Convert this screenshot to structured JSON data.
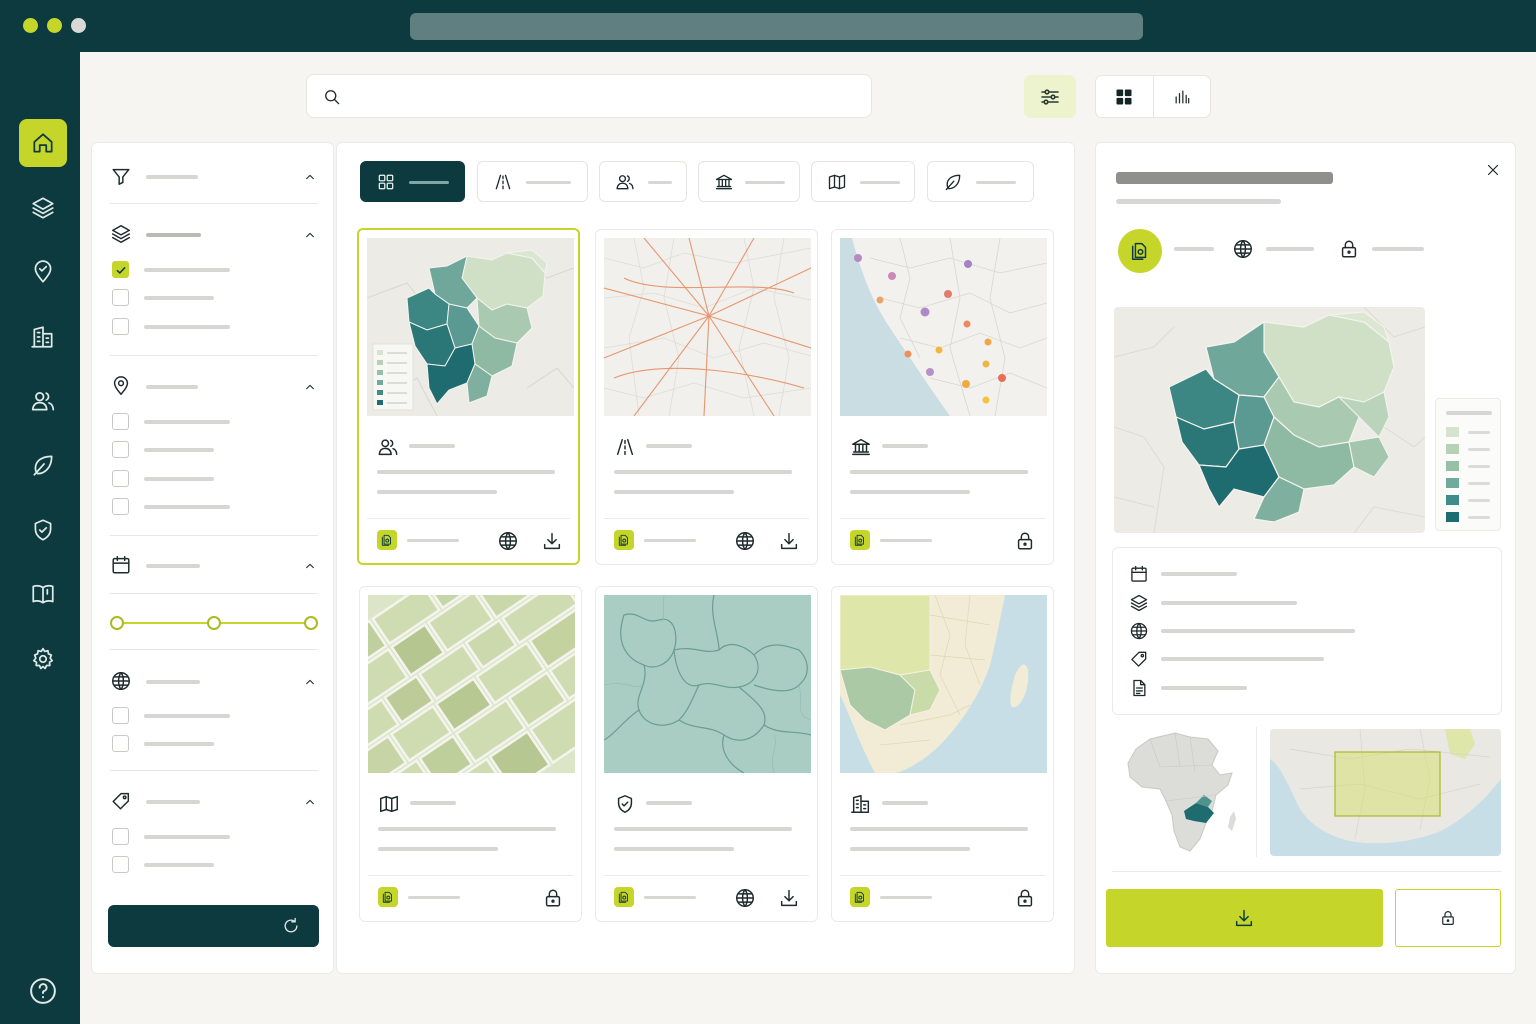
{
  "window": {
    "traffic_lights": [
      "#c6d52a",
      "#c6d52a",
      "#d9d9d6"
    ],
    "url": ""
  },
  "colors": {
    "accent": "#c6d52a",
    "sidebar": "#0c3a3e",
    "canvas": "#f6f5f2",
    "teal_dark": "#1f6f72",
    "teal_mid": "#5f9e98",
    "teal_light": "#b9d4c2"
  },
  "sidebar": {
    "items": [
      {
        "name": "home",
        "icon": "home-icon",
        "active": true
      },
      {
        "name": "layers",
        "icon": "layers-icon",
        "active": false
      },
      {
        "name": "location",
        "icon": "map-pin-icon",
        "active": false
      },
      {
        "name": "buildings",
        "icon": "building-icon",
        "active": false
      },
      {
        "name": "users",
        "icon": "users-icon",
        "active": false
      },
      {
        "name": "environment",
        "icon": "leaf-icon",
        "active": false
      },
      {
        "name": "security",
        "icon": "shield-icon",
        "active": false
      },
      {
        "name": "catalog",
        "icon": "book-map-icon",
        "active": false
      },
      {
        "name": "settings",
        "icon": "gear-icon",
        "active": false
      }
    ],
    "help_icon": "help-icon"
  },
  "search": {
    "icon": "search-icon",
    "value": "",
    "placeholder": ""
  },
  "toolbar": {
    "filter_icon": "sliders-icon",
    "view_grid_icon": "grid-icon",
    "view_chart_icon": "bar-chart-icon",
    "active_view": "grid"
  },
  "filters": {
    "sections": [
      {
        "icon": "filter-icon",
        "expanded": true,
        "options": []
      },
      {
        "icon": "layers-icon",
        "expanded": true,
        "options": [
          true,
          false,
          false
        ]
      },
      {
        "icon": "map-pin-icon",
        "expanded": true,
        "options": [
          false,
          false,
          false,
          false
        ]
      },
      {
        "icon": "calendar-icon",
        "expanded": true,
        "range": [
          0,
          0.5,
          1
        ]
      },
      {
        "icon": "globe-icon",
        "expanded": true,
        "options": [
          false,
          false
        ]
      },
      {
        "icon": "tag-icon",
        "expanded": true,
        "options": [
          false,
          false
        ]
      }
    ],
    "reset_label": "",
    "reset_icon": "refresh-icon"
  },
  "categories": [
    {
      "icon": "grid-icon",
      "active": true
    },
    {
      "icon": "road-icon",
      "active": false
    },
    {
      "icon": "users-icon",
      "active": false
    },
    {
      "icon": "institution-icon",
      "active": false
    },
    {
      "icon": "map-icon",
      "active": false
    },
    {
      "icon": "leaf-icon",
      "active": false
    }
  ],
  "datasets": [
    {
      "type_icon": "users-icon",
      "thumb": "choropleth",
      "access": "open",
      "selected": true
    },
    {
      "type_icon": "road-icon",
      "thumb": "roads",
      "access": "open",
      "selected": false
    },
    {
      "type_icon": "institution-icon",
      "thumb": "points",
      "access": "restricted",
      "selected": false
    },
    {
      "type_icon": "map-icon",
      "thumb": "parcels",
      "access": "restricted",
      "selected": false
    },
    {
      "type_icon": "shield-icon",
      "thumb": "regions",
      "access": "open",
      "selected": false
    },
    {
      "type_icon": "building-icon",
      "thumb": "southern-africa",
      "access": "restricted",
      "selected": false
    }
  ],
  "detail": {
    "title": "",
    "subtitle": "",
    "meta_icons": [
      "document-badge-icon",
      "globe-icon",
      "lock-icon"
    ],
    "legend_colors": [
      "#d6e4cf",
      "#b7d1b4",
      "#96c0a6",
      "#6faa9c",
      "#3f8c8a",
      "#1c6e72"
    ],
    "info_icons": [
      "calendar-icon",
      "layers-icon",
      "globe-icon",
      "tag-icon",
      "document-icon"
    ],
    "download_label": "",
    "download_icon": "download-icon",
    "lock_icon": "lock-icon",
    "close_icon": "close-icon"
  }
}
